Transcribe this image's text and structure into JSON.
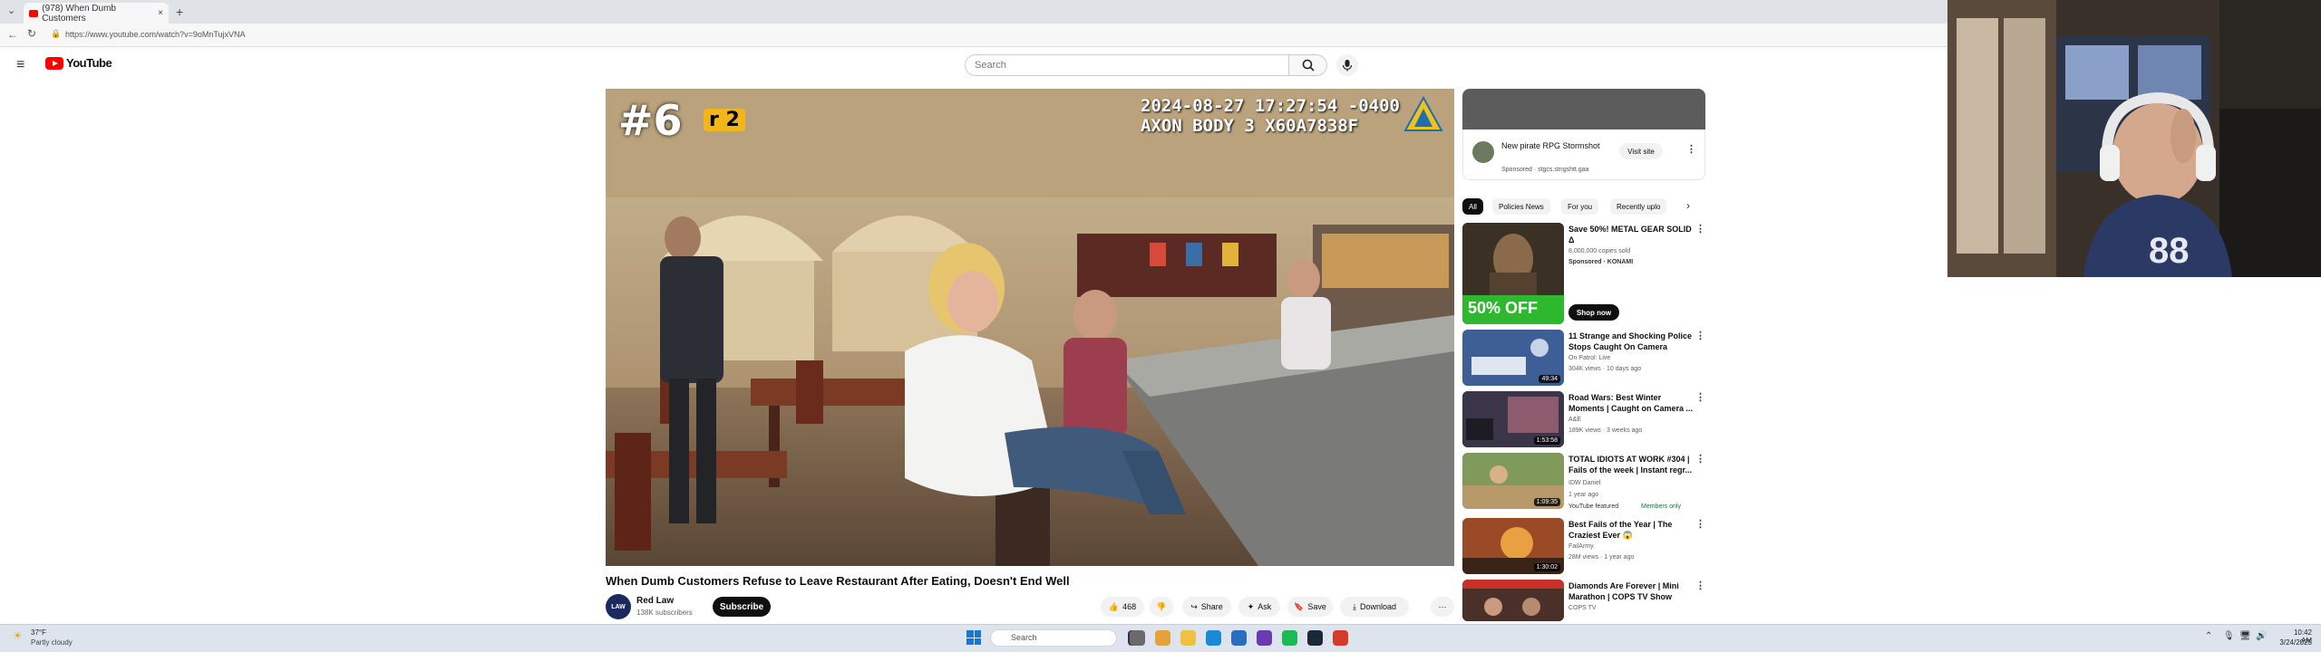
{
  "browser": {
    "tab_title": "(978) When Dumb Customers",
    "tab_close": "×",
    "new_tab": "+",
    "url": "https://www.youtube.com/watch?v=9oMnTujxVNA"
  },
  "youtube": {
    "logo_text": "YouTube",
    "search_placeholder": "Search"
  },
  "video": {
    "overlay_rank": "#6",
    "overlay_part": "r 2",
    "cam_timestamp": "2024-08-27 17:27:54 -0400",
    "cam_device": "AXON BODY 3 X60A7838F",
    "title": "When Dumb Customers Refuse to Leave Restaurant After Eating, Doesn't End Well",
    "channel_avatar": "LAW",
    "channel_name": "Red Law",
    "channel_subs": "138K subscribers",
    "subscribe": "Subscribe",
    "likes": "468",
    "share": "Share",
    "ask": "Ask",
    "save": "Save",
    "download": "Download",
    "more": "···"
  },
  "sidebar": {
    "ad": {
      "title": "New pirate RPG Stormshot",
      "sponsored": "Sponsored · stgcs.stngshtt.gaa",
      "visit": "Visit site"
    },
    "chips": [
      "All",
      "Policies News",
      "For you",
      "Recently uplo"
    ],
    "recommendations": [
      {
        "title": "Save 50%! METAL GEAR SOLID Δ",
        "channel": "8,000,000 copies sold",
        "meta": "Sponsored · KONAMI",
        "duration": "",
        "thumb_text": "50% OFF",
        "cta": "Shop now"
      },
      {
        "title": "11 Strange and Shocking Police Stops Caught On Camera",
        "channel": "On Patrol: Live",
        "meta": "304K views · 10 days ago",
        "duration": "49:34"
      },
      {
        "title": "Road Wars: Best Winter Moments | Caught on Camera ...",
        "channel": "A&E",
        "meta": "189K views · 3 weeks ago",
        "duration": "1:53:58"
      },
      {
        "title": "TOTAL IDIOTS AT WORK #304 | Fails of the week | Instant regr...",
        "channel": "IDW Daniel",
        "meta": "1 year ago",
        "duration": "1:09:35",
        "featured": "YouTube featured",
        "members": "Members only"
      },
      {
        "title": "Best Fails of the Year | The Craziest Ever 😱",
        "channel": "FailArmy",
        "meta": "28M views · 1 year ago",
        "duration": "1:30:02"
      },
      {
        "title": "Diamonds Are Forever | Mini Marathon | COPS TV Show",
        "channel": "COPS TV",
        "meta": "",
        "duration": ""
      }
    ]
  },
  "taskbar": {
    "weather_temp": "37°F",
    "weather_desc": "Partly cloudy",
    "search": "Search",
    "time": "10:42 AM",
    "date": "3/24/2025"
  },
  "colors": {
    "yt_red": "#ff0000",
    "accent_blue": "#1b76d2",
    "offer_green": "#2eb82e"
  }
}
